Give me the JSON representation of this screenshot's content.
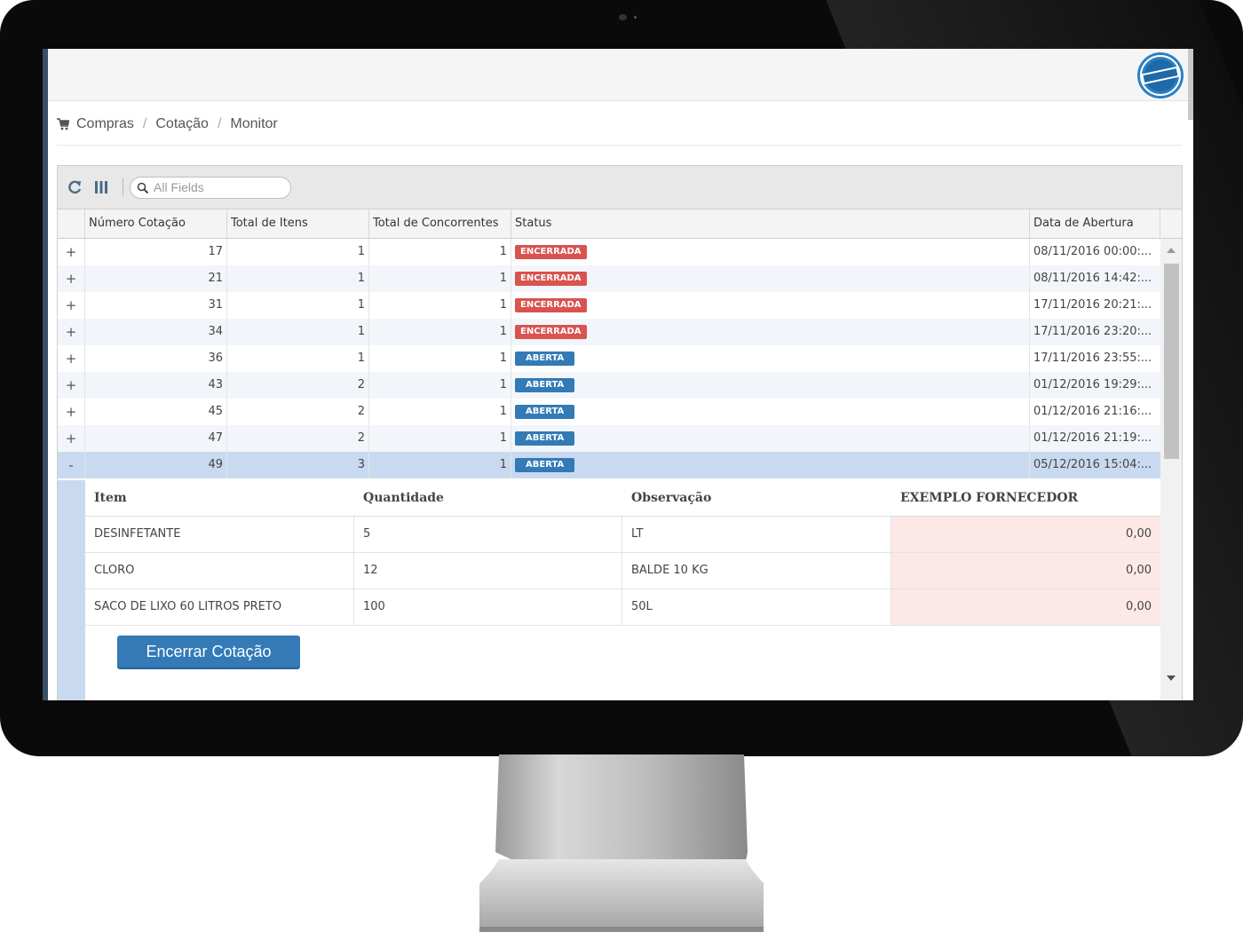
{
  "breadcrumb": {
    "items": [
      "Compras",
      "Cotação",
      "Monitor"
    ],
    "separator": "/"
  },
  "toolbar": {
    "search_placeholder": "All Fields"
  },
  "grid": {
    "columns": [
      "Número Cotação",
      "Total de Itens",
      "Total de Concorrentes",
      "Status",
      "Data de Abertura"
    ],
    "rows": [
      {
        "expander": "+",
        "numero": "17",
        "itens": "1",
        "concorrentes": "1",
        "status": "ENCERRADA",
        "data": "08/11/2016 00:00:..."
      },
      {
        "expander": "+",
        "numero": "21",
        "itens": "1",
        "concorrentes": "1",
        "status": "ENCERRADA",
        "data": "08/11/2016 14:42:..."
      },
      {
        "expander": "+",
        "numero": "31",
        "itens": "1",
        "concorrentes": "1",
        "status": "ENCERRADA",
        "data": "17/11/2016 20:21:..."
      },
      {
        "expander": "+",
        "numero": "34",
        "itens": "1",
        "concorrentes": "1",
        "status": "ENCERRADA",
        "data": "17/11/2016 23:20:..."
      },
      {
        "expander": "+",
        "numero": "36",
        "itens": "1",
        "concorrentes": "1",
        "status": "ABERTA",
        "data": "17/11/2016 23:55:..."
      },
      {
        "expander": "+",
        "numero": "43",
        "itens": "2",
        "concorrentes": "1",
        "status": "ABERTA",
        "data": "01/12/2016 19:29:..."
      },
      {
        "expander": "+",
        "numero": "45",
        "itens": "2",
        "concorrentes": "1",
        "status": "ABERTA",
        "data": "01/12/2016 21:16:..."
      },
      {
        "expander": "+",
        "numero": "47",
        "itens": "2",
        "concorrentes": "1",
        "status": "ABERTA",
        "data": "01/12/2016 21:19:..."
      },
      {
        "expander": "-",
        "numero": "49",
        "itens": "3",
        "concorrentes": "1",
        "status": "ABERTA",
        "data": "05/12/2016 15:04:..."
      }
    ]
  },
  "detail": {
    "columns": [
      "Item",
      "Quantidade",
      "Observação",
      "EXEMPLO FORNECEDOR"
    ],
    "rows": [
      {
        "item": "DESINFETANTE",
        "quantidade": "5",
        "observacao": "LT",
        "valor": "0,00"
      },
      {
        "item": "CLORO",
        "quantidade": "12",
        "observacao": "BALDE 10 KG",
        "valor": "0,00"
      },
      {
        "item": "SACO DE LIXO 60 LITROS PRETO",
        "quantidade": "100",
        "observacao": "50L",
        "valor": "0,00"
      }
    ],
    "button_label": "Encerrar Cotação"
  },
  "colors": {
    "status_encerrada": "#d9534f",
    "status_aberta": "#337ab7",
    "selected_row": "#c9daf0",
    "supplier_cell": "#fde8e8",
    "primary_button": "#337ab7"
  },
  "icons": {
    "breadcrumb": "shopping-cart-icon",
    "refresh": "refresh-icon",
    "columns": "columns-icon",
    "search": "search-icon",
    "logo": "resolvido-logo"
  }
}
